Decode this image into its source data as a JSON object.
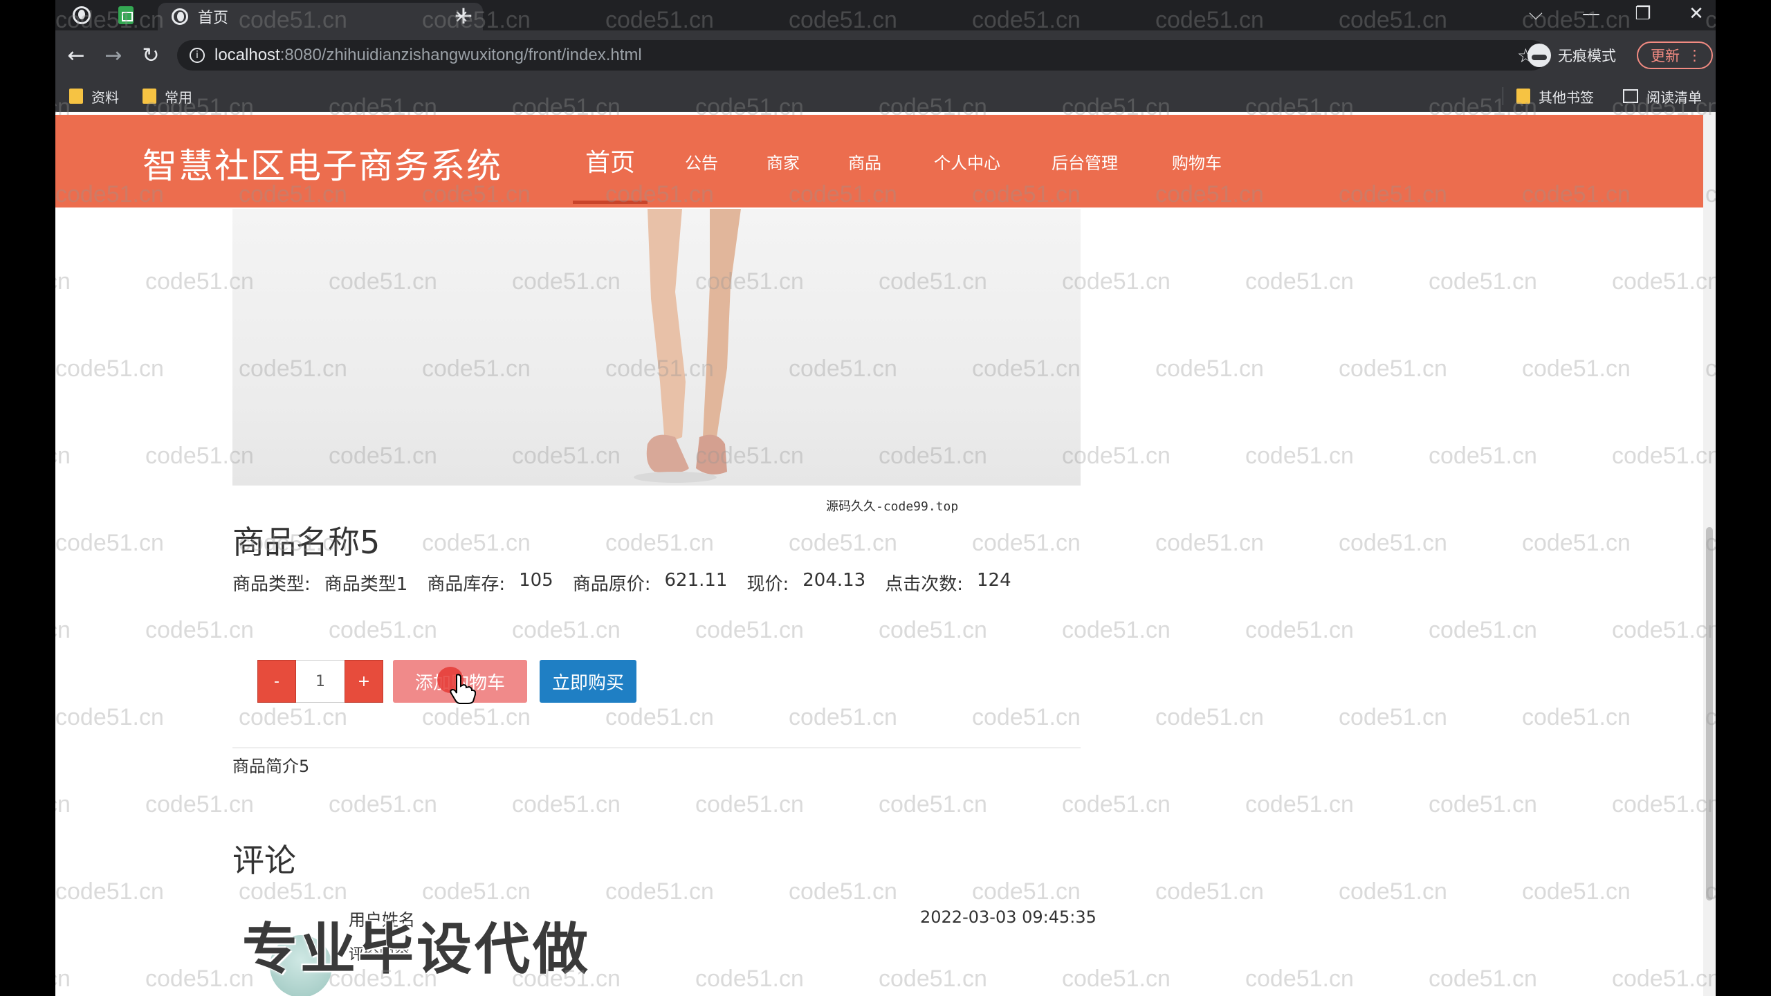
{
  "browser": {
    "tab_title": "首页",
    "tab_close": "×",
    "new_tab": "+",
    "window_controls": {
      "dropdown": "⌵",
      "minimize": "—",
      "restore": "❐",
      "close": "✕"
    },
    "nav": {
      "back": "←",
      "forward": "→",
      "reload": "↻"
    },
    "url_host": "localhost",
    "url_rest": ":8080/zhihuidianzishangwuxitong/front/index.html",
    "star": "☆",
    "incognito_label": "无痕模式",
    "update_label": "更新",
    "update_menu": "⋮",
    "bookmarks": [
      "资料",
      "常用"
    ],
    "other_bookmarks": "其他书签",
    "reading_list": "阅读清单"
  },
  "site": {
    "title": "智慧社区电子商务系统",
    "nav": [
      "首页",
      "公告",
      "商家",
      "商品",
      "个人中心",
      "后台管理",
      "购物车"
    ],
    "active_nav": "首页"
  },
  "product": {
    "image_caption": "源码久久-code99.top",
    "name": "商品名称5",
    "type_label": "商品类型:",
    "type_value": "商品类型1",
    "stock_label": "商品库存:",
    "stock_value": "105",
    "orig_price_label": "商品原价:",
    "orig_price_value": "621.11",
    "price_label": "现价:",
    "price_value": "204.13",
    "clicks_label": "点击次数:",
    "clicks_value": "124",
    "qty_minus": "-",
    "qty_value": "1",
    "qty_plus": "+",
    "add_to_cart": "添加购物车",
    "buy_now": "立即购买",
    "description": "商品简介5"
  },
  "comments": {
    "title": "评论",
    "items": [
      {
        "user": "用户姓名",
        "content": "评价内容",
        "time": "2022-03-03 09:45:35"
      }
    ]
  },
  "overlay": {
    "promo_text": "专业毕设代做",
    "watermark_text": "code51.cn"
  },
  "colors": {
    "header_bg": "#ec6d4e",
    "add_cart_bg": "#f08a8a",
    "buy_now_bg": "#1f7fc4",
    "qty_btn_bg": "#e74c3c"
  }
}
